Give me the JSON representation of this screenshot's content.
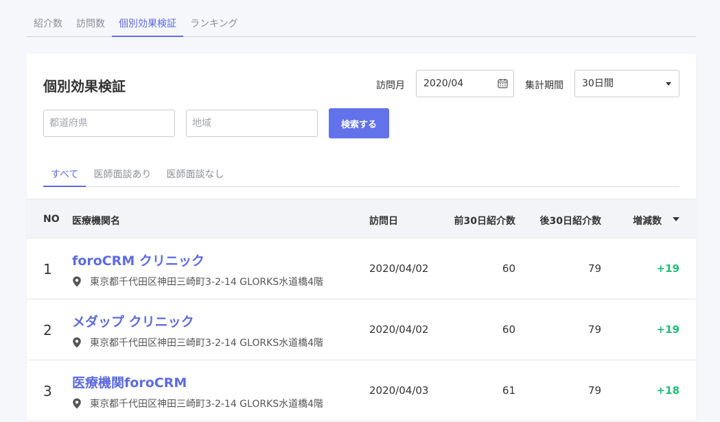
{
  "top_tabs": [
    {
      "label": "紹介数"
    },
    {
      "label": "訪問数"
    },
    {
      "label": "個別効果検証"
    },
    {
      "label": "ランキング"
    }
  ],
  "page": {
    "title": "個別効果検証"
  },
  "filters": {
    "visit_month_label": "訪問月",
    "visit_month_value": "2020/04",
    "period_label": "集計期間",
    "period_value": "30日間",
    "prefecture_placeholder": "都道府県",
    "region_placeholder": "地域",
    "search_label": "検索する"
  },
  "sub_tabs": [
    {
      "label": "すべて"
    },
    {
      "label": "医師面談あり"
    },
    {
      "label": "医師面談なし"
    }
  ],
  "table": {
    "headers": {
      "no": "NO",
      "name": "医療機関名",
      "date": "訪問日",
      "before": "前30日紹介数",
      "after": "後30日紹介数",
      "diff": "増減数"
    },
    "rows": [
      {
        "no": "1",
        "name": "foroCRM クリニック",
        "address": "東京都千代田区神田三崎町3-2-14 GLORKS水道橋4階",
        "date": "2020/04/02",
        "before": "60",
        "after": "79",
        "diff": "+19"
      },
      {
        "no": "2",
        "name": "メダップ クリニック",
        "address": "東京都千代田区神田三崎町3-2-14 GLORKS水道橋4階",
        "date": "2020/04/02",
        "before": "60",
        "after": "79",
        "diff": "+19"
      },
      {
        "no": "3",
        "name": "医療機関foroCRM",
        "address": "東京都千代田区神田三崎町3-2-14 GLORKS水道橋4階",
        "date": "2020/04/03",
        "before": "61",
        "after": "79",
        "diff": "+18"
      }
    ]
  },
  "colors": {
    "accent": "#5d6be0",
    "button": "#6272ea",
    "positive": "#1dbf73"
  },
  "icons": {
    "calendar": "calendar-icon",
    "select": "chevron-down-icon",
    "location": "location-pin-icon",
    "sort": "sort-caret-icon"
  }
}
